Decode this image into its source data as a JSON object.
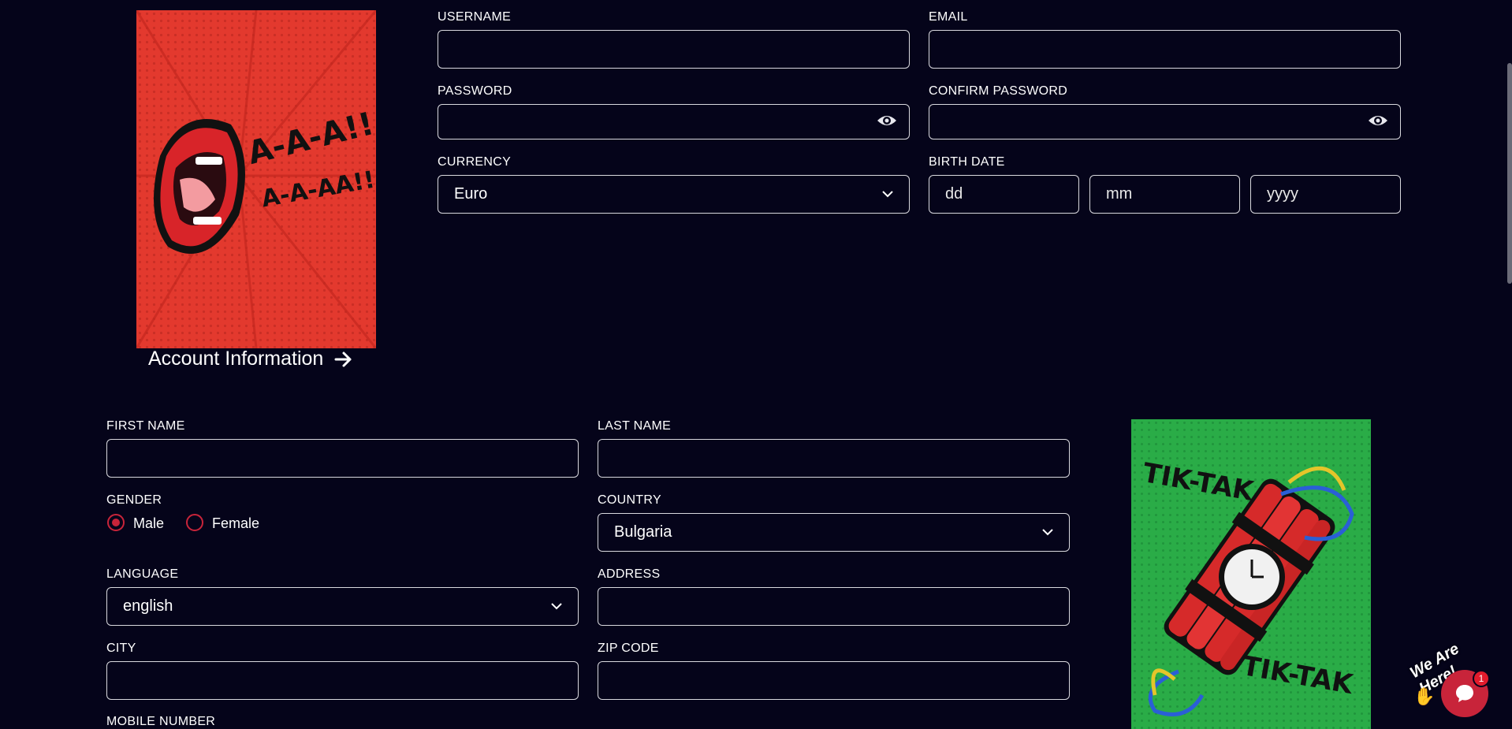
{
  "account_card": {
    "poster_text_1": "A-A-A!!",
    "poster_text_2": "A-A-AA!!",
    "caption": "Account Information"
  },
  "account_form": {
    "username_label": "USERNAME",
    "email_label": "EMAIL",
    "password_label": "PASSWORD",
    "confirm_password_label": "CONFIRM PASSWORD",
    "currency_label": "CURRENCY",
    "currency_value": "Euro",
    "birth_date_label": "BIRTH DATE",
    "birth_day_placeholder": "dd",
    "birth_month_placeholder": "mm",
    "birth_year_placeholder": "yyyy"
  },
  "personal_form": {
    "first_name_label": "FIRST NAME",
    "last_name_label": "LAST NAME",
    "gender_label": "GENDER",
    "gender_options": [
      "Male",
      "Female"
    ],
    "gender_selected": "Male",
    "country_label": "COUNTRY",
    "country_value": "Bulgaria",
    "language_label": "LANGUAGE",
    "language_value": "english",
    "address_label": "ADDRESS",
    "city_label": "CITY",
    "zip_label": "ZIP CODE",
    "mobile_label": "MOBILE NUMBER"
  },
  "personal_card": {
    "poster_text_1": "TIK-TAK",
    "poster_text_2": "TIK-TAK"
  },
  "chat_widget": {
    "tag_text": "We Are Here!",
    "badge_count": "1"
  },
  "colors": {
    "background": "#05041a",
    "accent": "#c8243a",
    "poster_red": "#e5322c",
    "poster_green": "#27a844"
  }
}
